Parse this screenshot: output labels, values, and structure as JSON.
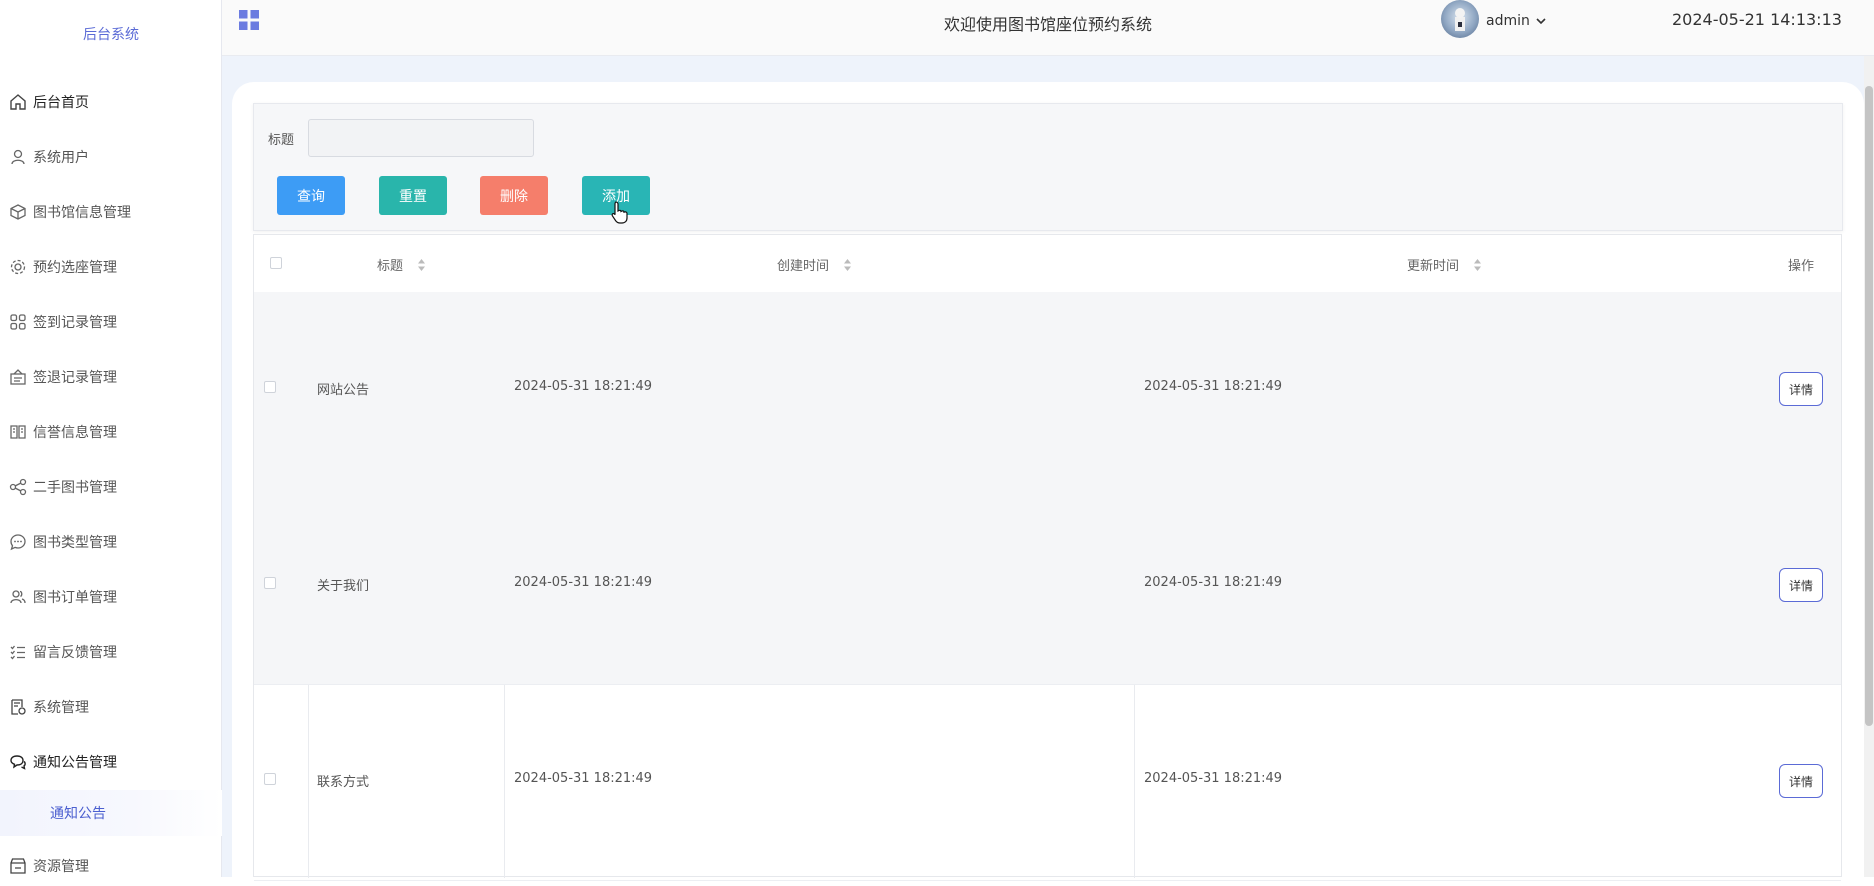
{
  "sidebar": {
    "brand": "后台系统",
    "items": [
      {
        "label": "后台首页"
      },
      {
        "label": "系统用户"
      },
      {
        "label": "图书馆信息管理"
      },
      {
        "label": "预约选座管理"
      },
      {
        "label": "签到记录管理"
      },
      {
        "label": "签退记录管理"
      },
      {
        "label": "信誉信息管理"
      },
      {
        "label": "二手图书管理"
      },
      {
        "label": "图书类型管理"
      },
      {
        "label": "图书订单管理"
      },
      {
        "label": "留言反馈管理"
      },
      {
        "label": "系统管理"
      },
      {
        "label": "通知公告管理"
      },
      {
        "label": "资源管理"
      }
    ],
    "active_sub": "通知公告"
  },
  "header": {
    "title": "欢迎使用图书馆座位预约系统",
    "user": "admin",
    "datetime": "2024-05-21 14:13:13"
  },
  "search": {
    "label": "标题",
    "value": "",
    "buttons": {
      "query": "查询",
      "reset": "重置",
      "delete": "删除",
      "add": "添加"
    }
  },
  "table": {
    "headers": {
      "title": "标题",
      "created": "创建时间",
      "updated": "更新时间",
      "actions": "操作"
    },
    "rows": [
      {
        "title": "网站公告",
        "created": "2024-05-31 18:21:49",
        "updated": "2024-05-31 18:21:49",
        "action": "详情"
      },
      {
        "title": "关于我们",
        "created": "2024-05-31 18:21:49",
        "updated": "2024-05-31 18:21:49",
        "action": "详情"
      },
      {
        "title": "联系方式",
        "created": "2024-05-31 18:21:49",
        "updated": "2024-05-31 18:21:49",
        "action": "详情"
      }
    ]
  },
  "colors": {
    "accent": "#5b6bd6",
    "query": "#3d9cf5",
    "reset": "#29b5ab",
    "delete": "#f57e6b",
    "add": "#29b5b5"
  }
}
